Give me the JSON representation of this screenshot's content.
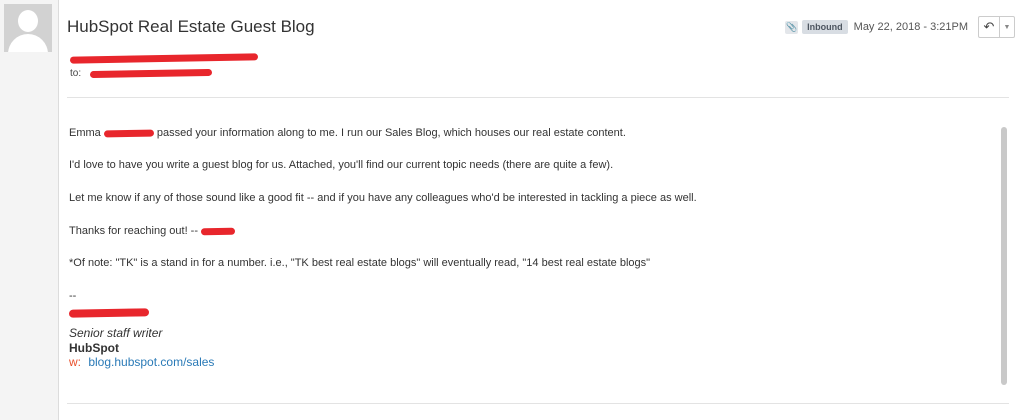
{
  "email": {
    "subject": "HubSpot Real Estate Guest Blog",
    "badge": "Inbound",
    "date": "May 22, 2018 - 3:21PM",
    "to_label": "to:",
    "paragraphs": [
      "Emma",
      "passed your information along to me. I run our Sales Blog, which houses our real estate content.",
      "I'd love to have you write a guest blog for us. Attached, you'll find our current topic needs (there are quite a few).",
      "Let me know if any of those sound like a good fit -- and if you have any colleagues who'd be interested in tackling a piece as well.",
      "Thanks for reaching out! --",
      "*Of note: \"TK\" is a stand in for a number. i.e., \"TK best real estate blogs\" will eventually read, \"14 best real estate blogs\""
    ],
    "signature": {
      "dashes": "--",
      "title": "Senior staff writer",
      "company": "HubSpot",
      "web_prefix": "w:",
      "web_link": "blog.hubspot.com/sales"
    }
  },
  "icons": {
    "attachment": "paperclip-icon",
    "reply": "reply-icon",
    "dropdown": "caret-down-icon",
    "avatar": "user-avatar"
  },
  "colors": {
    "redaction": "#e8262c",
    "link": "#2a7ab7",
    "web_prefix": "#e8502c"
  }
}
